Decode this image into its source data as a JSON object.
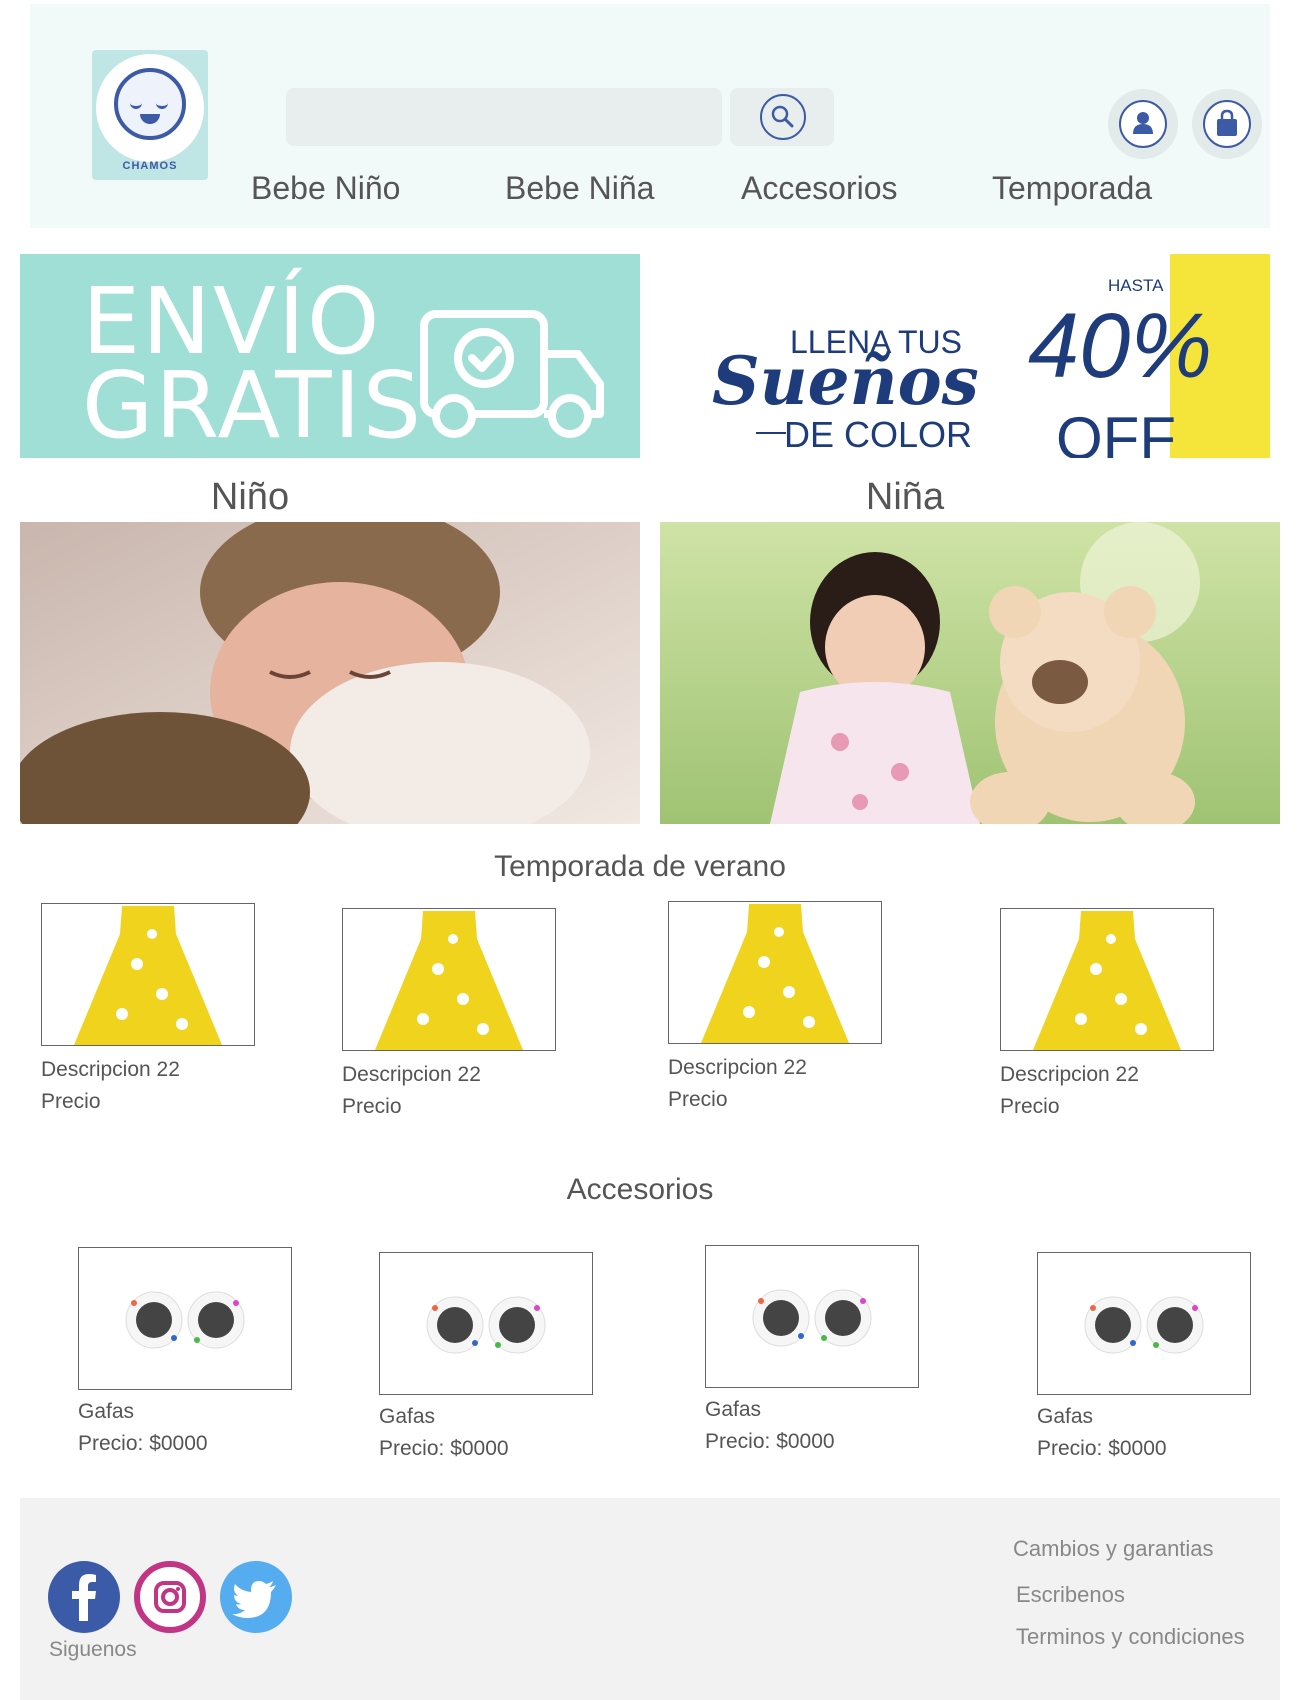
{
  "header": {
    "logo_text": "CHAMOS",
    "search": {
      "value": "",
      "placeholder": ""
    },
    "nav": [
      "Bebe Niño",
      "Bebe Niña",
      "Accesorios",
      "Temporada"
    ]
  },
  "banners": {
    "left": {
      "line1": "ENVÍO",
      "line2": "GRATIS"
    },
    "right": {
      "line1": "LLENA TUS",
      "line2": "Sueños",
      "line3": "DE COLOR",
      "hasta": "HASTA",
      "percent": "40%",
      "off": "OFF"
    }
  },
  "categories": [
    {
      "label": "Niño"
    },
    {
      "label": "Niña"
    }
  ],
  "summer": {
    "title": "Temporada de verano",
    "items": [
      {
        "description": "Descripcion 22",
        "price": "Precio"
      },
      {
        "description": "Descripcion 22",
        "price": "Precio"
      },
      {
        "description": "Descripcion 22",
        "price": "Precio"
      },
      {
        "description": "Descripcion 22",
        "price": "Precio"
      }
    ]
  },
  "accessories": {
    "title": "Accesorios",
    "items": [
      {
        "name": "Gafas",
        "price": "Precio: $0000"
      },
      {
        "name": "Gafas",
        "price": "Precio: $0000"
      },
      {
        "name": "Gafas",
        "price": "Precio: $0000"
      },
      {
        "name": "Gafas",
        "price": "Precio: $0000"
      }
    ]
  },
  "footer": {
    "follow": "Siguenos",
    "links": [
      "Cambios y garantias",
      "Escribenos",
      "Terminos y condiciones"
    ],
    "social_icons": [
      "facebook-icon",
      "instagram-icon",
      "twitter-icon"
    ]
  },
  "colors": {
    "header_bg": "#f2f9f9",
    "brand_blue": "#3d5aa6",
    "banner_mint": "#9fdfd6",
    "banner_yellow": "#f5e43a",
    "footer_bg": "#f2f2f2"
  }
}
